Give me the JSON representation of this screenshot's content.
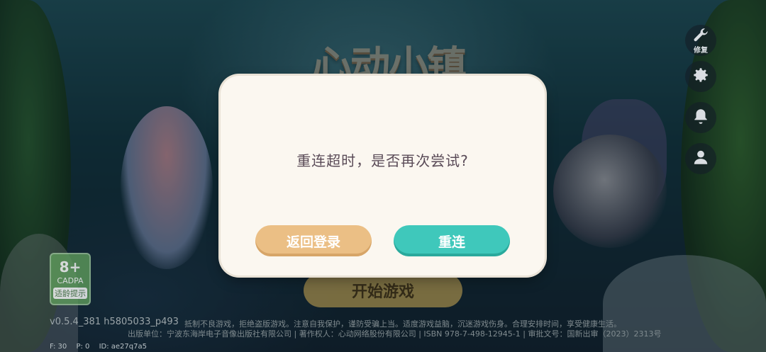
{
  "game": {
    "logo_text": "心动小镇"
  },
  "side_menu": {
    "repair_label": "修复",
    "icons": [
      "wrench-icon",
      "gear-icon",
      "bell-icon",
      "user-icon"
    ]
  },
  "age_rating": {
    "age": "8+",
    "org": "CADPA",
    "tip": "适龄提示"
  },
  "start_button_label": "开始游戏",
  "dialog": {
    "message": "重连超时，是否再次尝试?",
    "back_label": "返回登录",
    "retry_label": "重连"
  },
  "footer": {
    "version": "v0.5.4_381 h5805033_p493",
    "notice": "抵制不良游戏，拒绝盗版游戏。注意自我保护，谨防受骗上当。适度游戏益脑，沉迷游戏伤身。合理安排时间，享受健康生活。",
    "publisher": "出版单位：宁波东海岸电子音像出版社有限公司 | 著作权人：心动网络股份有限公司 | ISBN 978-7-498-12945-1 | 审批文号：国新出审（2023）2313号",
    "debug_f": "F: 30",
    "debug_p": "P: 0",
    "debug_id": "ID: ae27q7a5"
  },
  "colors": {
    "dialog_bg": "#fbf7f0",
    "back_button": "#ebbf85",
    "retry_button": "#3fc8bb",
    "message_text": "#5a4b57"
  }
}
